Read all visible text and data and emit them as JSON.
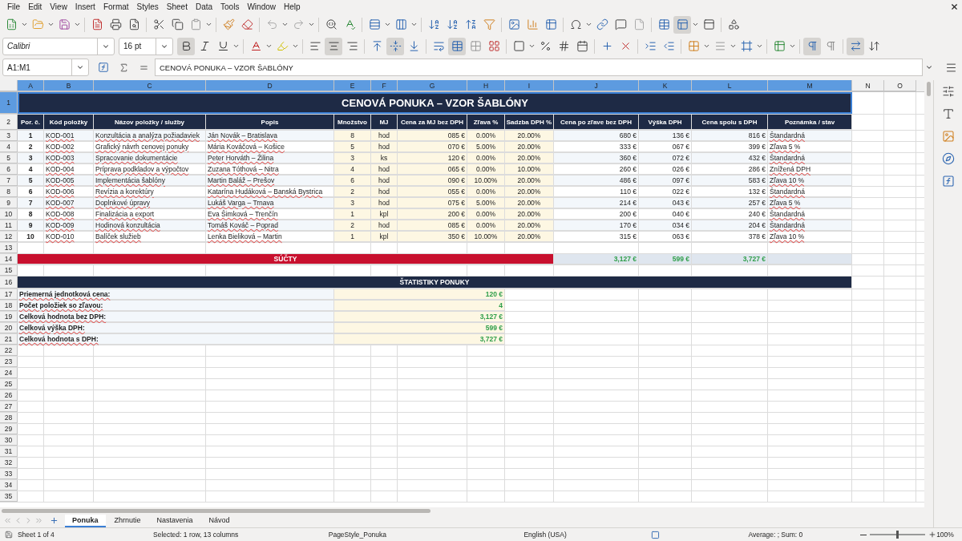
{
  "menu": [
    "File",
    "Edit",
    "View",
    "Insert",
    "Format",
    "Styles",
    "Sheet",
    "Data",
    "Tools",
    "Window",
    "Help"
  ],
  "formatting": {
    "bold": true,
    "italic": false,
    "underline": false,
    "align_left": false,
    "align_center": true,
    "align_right": false,
    "align_top": false,
    "align_middle": true,
    "align_bottom": false,
    "wrap": false,
    "merge": true,
    "ltr": true,
    "rtl": false,
    "text_flow": true,
    "freeze": true
  },
  "font": {
    "name": "Calibri",
    "size": "16 pt"
  },
  "formula_bar": {
    "name_box": "A1:M1",
    "value": "CENOVÁ PONUKA – VZOR ŠABLÓNY"
  },
  "columns": [
    {
      "label": "A",
      "selected": true
    },
    {
      "label": "B",
      "selected": true
    },
    {
      "label": "C",
      "selected": true
    },
    {
      "label": "D",
      "selected": true
    },
    {
      "label": "E",
      "selected": true
    },
    {
      "label": "F",
      "selected": true
    },
    {
      "label": "G",
      "selected": true
    },
    {
      "label": "H",
      "selected": true
    },
    {
      "label": "I",
      "selected": true
    },
    {
      "label": "J",
      "selected": true
    },
    {
      "label": "K",
      "selected": true
    },
    {
      "label": "L",
      "selected": true
    },
    {
      "label": "M",
      "selected": true
    },
    {
      "label": "N",
      "selected": false
    },
    {
      "label": "O",
      "selected": false
    }
  ],
  "row_headers": [
    {
      "label": "1",
      "selected": true
    },
    {
      "label": "2",
      "selected": false
    },
    {
      "label": "3",
      "selected": false
    },
    {
      "label": "4",
      "selected": false
    },
    {
      "label": "5",
      "selected": false
    },
    {
      "label": "6",
      "selected": false
    },
    {
      "label": "7",
      "selected": false
    },
    {
      "label": "8",
      "selected": false
    },
    {
      "label": "9",
      "selected": false
    },
    {
      "label": "10",
      "selected": false
    },
    {
      "label": "11",
      "selected": false
    },
    {
      "label": "12",
      "selected": false
    },
    {
      "label": "13",
      "selected": false
    },
    {
      "label": "14",
      "selected": false
    },
    {
      "label": "15",
      "selected": false
    },
    {
      "label": "16",
      "selected": false
    },
    {
      "label": "17",
      "selected": false
    },
    {
      "label": "18",
      "selected": false
    },
    {
      "label": "19",
      "selected": false
    },
    {
      "label": "20",
      "selected": false
    },
    {
      "label": "21",
      "selected": false
    },
    {
      "label": "22",
      "selected": false
    },
    {
      "label": "23",
      "selected": false
    },
    {
      "label": "24",
      "selected": false
    },
    {
      "label": "25",
      "selected": false
    },
    {
      "label": "26",
      "selected": false
    },
    {
      "label": "27",
      "selected": false
    },
    {
      "label": "28",
      "selected": false
    },
    {
      "label": "29",
      "selected": false
    },
    {
      "label": "30",
      "selected": false
    },
    {
      "label": "31",
      "selected": false
    },
    {
      "label": "32",
      "selected": false
    },
    {
      "label": "33",
      "selected": false
    },
    {
      "label": "34",
      "selected": false
    },
    {
      "label": "35",
      "selected": false
    }
  ],
  "title": "CENOVÁ PONUKA – VZOR ŠABLÓNY",
  "headers": [
    "Por. č.",
    "Kód položky",
    "Názov položky / služby",
    "Popis",
    "Množstvo",
    "MJ",
    "Cena za MJ bez DPH",
    "Zľava %",
    "Sadzba DPH %",
    "Cena po zľave bez DPH",
    "Výška DPH",
    "Cena spolu s DPH",
    "Poznámka / stav"
  ],
  "items": [
    {
      "cells": [
        "1",
        "KOD-001",
        "Konzultácia a analýza požiadaviek",
        "Ján Novák – Bratislava",
        "8",
        "hod",
        "085 €",
        "0.00%",
        "20.00%",
        "680 €",
        "136 €",
        "816 €",
        "Štandardná"
      ]
    },
    {
      "cells": [
        "2",
        "KOD-002",
        "Grafický návrh cenovej ponuky",
        "Mária Kováčová – Košice",
        "5",
        "hod",
        "070 €",
        "5.00%",
        "20.00%",
        "333 €",
        "067 €",
        "399 €",
        "Zľava 5 %"
      ]
    },
    {
      "cells": [
        "3",
        "KOD-003",
        "Spracovanie dokumentácie",
        "Peter Horváth – Žilina",
        "3",
        "ks",
        "120 €",
        "0.00%",
        "20.00%",
        "360 €",
        "072 €",
        "432 €",
        "Štandardná"
      ]
    },
    {
      "cells": [
        "4",
        "KOD-004",
        "Príprava podkladov a výpočtov",
        "Zuzana Tóthová – Nitra",
        "4",
        "hod",
        "065 €",
        "0.00%",
        "10.00%",
        "260 €",
        "026 €",
        "286 €",
        "Znížená DPH"
      ]
    },
    {
      "cells": [
        "5",
        "KOD-005",
        "Implementácia šablóny",
        "Martin Baláž – Prešov",
        "6",
        "hod",
        "090 €",
        "10.00%",
        "20.00%",
        "486 €",
        "097 €",
        "583 €",
        "Zľava 10 %"
      ]
    },
    {
      "cells": [
        "6",
        "KOD-006",
        "Revízia a korektúry",
        "Katarína Hudáková – Banská Bystrica",
        "2",
        "hod",
        "055 €",
        "0.00%",
        "20.00%",
        "110 €",
        "022 €",
        "132 €",
        "Štandardná"
      ]
    },
    {
      "cells": [
        "7",
        "KOD-007",
        "Doplnkové úpravy",
        "Lukáš Varga – Trnava",
        "3",
        "hod",
        "075 €",
        "5.00%",
        "20.00%",
        "214 €",
        "043 €",
        "257 €",
        "Zľava 5 %"
      ]
    },
    {
      "cells": [
        "8",
        "KOD-008",
        "Finalizácia a export",
        "Eva Šimková – Trenčín",
        "1",
        "kpl",
        "200 €",
        "0.00%",
        "20.00%",
        "200 €",
        "040 €",
        "240 €",
        "Štandardná"
      ]
    },
    {
      "cells": [
        "9",
        "KOD-009",
        "Hodinová konzultácia",
        "Tomáš Kováč – Poprad",
        "2",
        "hod",
        "085 €",
        "0.00%",
        "20.00%",
        "170 €",
        "034 €",
        "204 €",
        "Štandardná"
      ]
    },
    {
      "cells": [
        "10",
        "KOD-010",
        "Balíček služieb",
        "Lenka Bieliková – Martin",
        "1",
        "kpl",
        "350 €",
        "10.00%",
        "20.00%",
        "315 €",
        "063 €",
        "378 €",
        "Zľava 10 %"
      ]
    }
  ],
  "totals": {
    "label": "SÚČTY",
    "values": [
      "3,127 €",
      "599 €",
      "3,727 €"
    ]
  },
  "stats": {
    "title": "ŠTATISTIKY PONUKY",
    "rows": [
      {
        "label": "Priemerná jednotková cena:",
        "value": "120 €"
      },
      {
        "label": "Počet položiek so zľavou:",
        "value": "4"
      },
      {
        "label": "Celková hodnota bez DPH:",
        "value": "3,127 €"
      },
      {
        "label": "Celková výška DPH:",
        "value": "599 €"
      },
      {
        "label": "Celková hodnota s DPH:",
        "value": "3,727 €"
      }
    ]
  },
  "sheet_tabs": [
    {
      "label": "Ponuka",
      "selected": true
    },
    {
      "label": "Zhrnutie",
      "selected": false
    },
    {
      "label": "Nastavenia",
      "selected": false
    },
    {
      "label": "Návod",
      "selected": false
    }
  ],
  "status_bar": {
    "sheet": "Sheet 1 of 4",
    "selection": "Selected: 1 row, 13 columns",
    "page_style": "PageStyle_Ponuka",
    "language": "English (USA)",
    "summary": "Average: ; Sum: 0",
    "zoom": {
      "level": 0.5,
      "reading": "100%"
    }
  }
}
